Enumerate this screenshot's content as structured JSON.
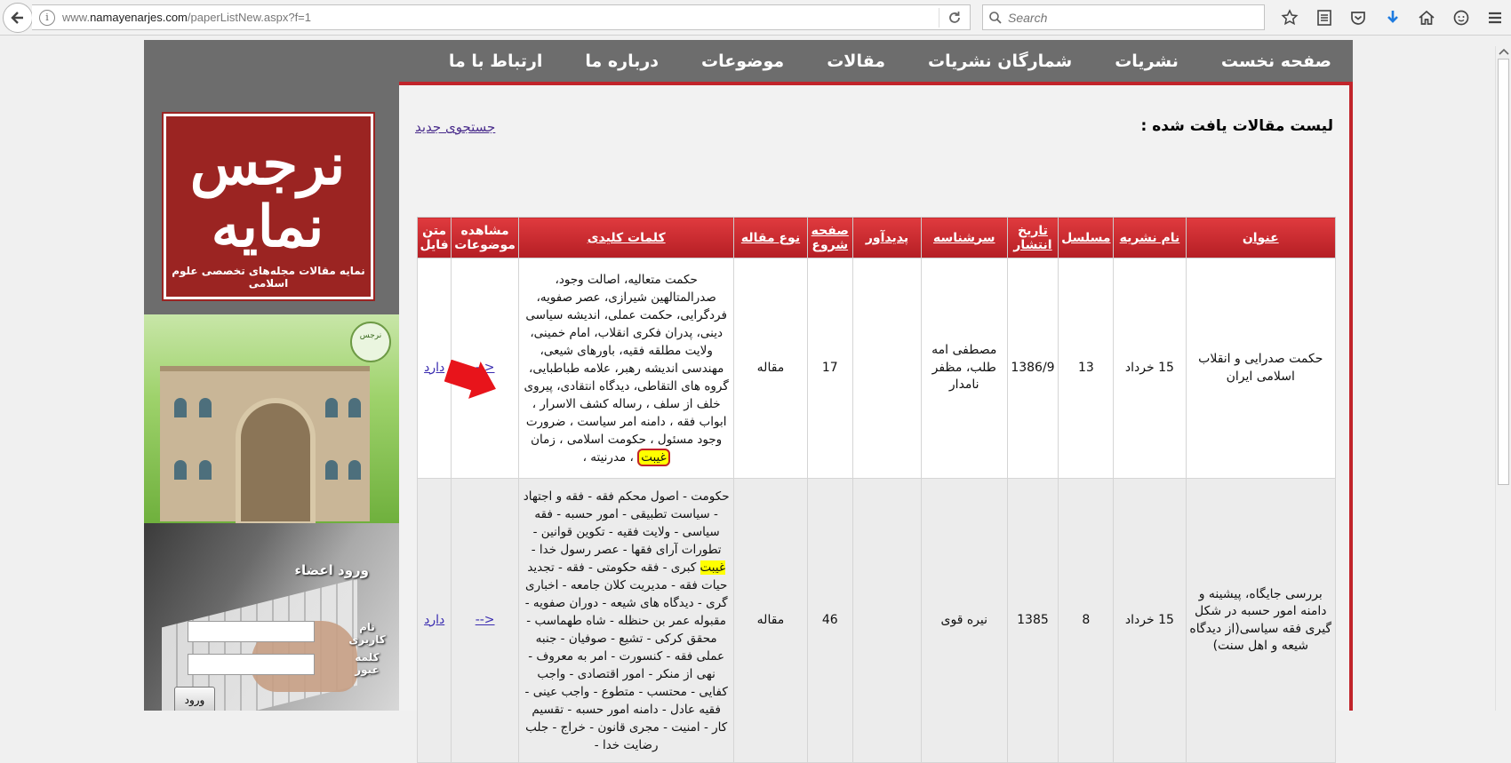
{
  "browser": {
    "url_prefix": "www.",
    "url_domain": "namayenarjes.com",
    "url_path": "/paperListNew.aspx?f=1",
    "search_placeholder": "Search"
  },
  "nav": {
    "items": [
      "صفحه نخست",
      "نشریات",
      "شمارگان نشریات",
      "مقالات",
      "موضوعات",
      "درباره ما",
      "ارتباط با ما"
    ]
  },
  "sidebar": {
    "logo_text": "نرجس نمایه",
    "logo_subtitle": "نمایه مقالات مجله‌های تخصصی علوم اسلامی",
    "badge_text": "نرجس",
    "login_title": "ورود اعضاء",
    "username_label": "نام کاربری",
    "password_label": "کلمه عبور",
    "login_button": "ورود"
  },
  "main": {
    "heading": "لیست مقالات یافت شده :",
    "new_search": "جستجوی جدید",
    "columns": [
      "عنوان",
      "نام نشریه",
      "مسلسل",
      "تاریخ انتشار",
      "سرشناسه",
      "پدیدآور",
      "صفحه شروع",
      "نوع مقاله",
      "کلمات کلیدی",
      "مشاهده موضوعات",
      "متن فایل"
    ],
    "rows": [
      {
        "title": "حکمت صدرایی و انقلاب اسلامی ایران",
        "journal": "15 خرداد",
        "serial": "13",
        "date": "1386/9",
        "header": "مصطفی امه طلب، مظفر نامدار",
        "author": "",
        "start_page": "17",
        "type": "مقاله",
        "keywords_before": "حکمت متعالیه، اصالت وجود، صدرالمتالهین شیرازی، عصر صفویه، فردگرایی، حکمت عملی، اندیشه سیاسی دینی، پدران فکری انقلاب، امام خمینی، ولایت مطلقه فقیه، باورهای شیعی، مهندسی اندیشه رهبر، علامه طباطبایی، گروه های التقاطی، دیدگاه انتقادی، پیروی خلف از سلف ، رساله کشف الاسرار ، ابواب فقه ، دامنه امر سیاست ، ضرورت وجود مسئول ، حکومت اسلامی ، زمان ",
        "keywords_highlight": "غیبت",
        "keywords_after": " ، مدرنیته ،",
        "view_topics": "<--",
        "file_text": "دارد"
      },
      {
        "title": "بررسی جایگاه، پیشینه و دامنه امور حسبه در شکل گیری فقه سیاسی(از دیدگاه شیعه و اهل سنت)",
        "journal": "15 خرداد",
        "serial": "8",
        "date": "1385",
        "header": "نیره قوی",
        "author": "",
        "start_page": "46",
        "type": "مقاله",
        "keywords_before": "حکومت - اصول محکم فقه - فقه و اجتهاد - سیاست تطبیقی - امور حسبه - فقه سیاسی - ولایت فقیه - تکوین قوانین - تطورات آرای فقها - عصر رسول خدا - ",
        "keywords_highlight": "غیبت",
        "keywords_after": " کبری - فقه حکومتی - فقه - تجدید حیات فقه - مدیریت کلان جامعه - اخباری گری - دیدگاه های شیعه - دوران صفویه - مقبوله عمر بن حنظله - شاه طهماسب - محقق کرکی - تشیع - صوفیان - جنبه عملی فقه - کنسورت - امر به معروف - نهی از منکر - امور اقتصادی - واجب کفایی - محتسب - متطوع - واجب عینی - فقیه عادل - دامنه امور حسبه - تقسیم کار - امنیت - مجری قانون - خراج - جلب رضایت خدا -",
        "view_topics": "<--",
        "file_text": "دارد"
      }
    ]
  },
  "colors": {
    "accent_red": "#c1242b",
    "nav_gray": "#6d6d6d",
    "link_purple": "#4a2d8c",
    "highlight": "#ffff00"
  }
}
